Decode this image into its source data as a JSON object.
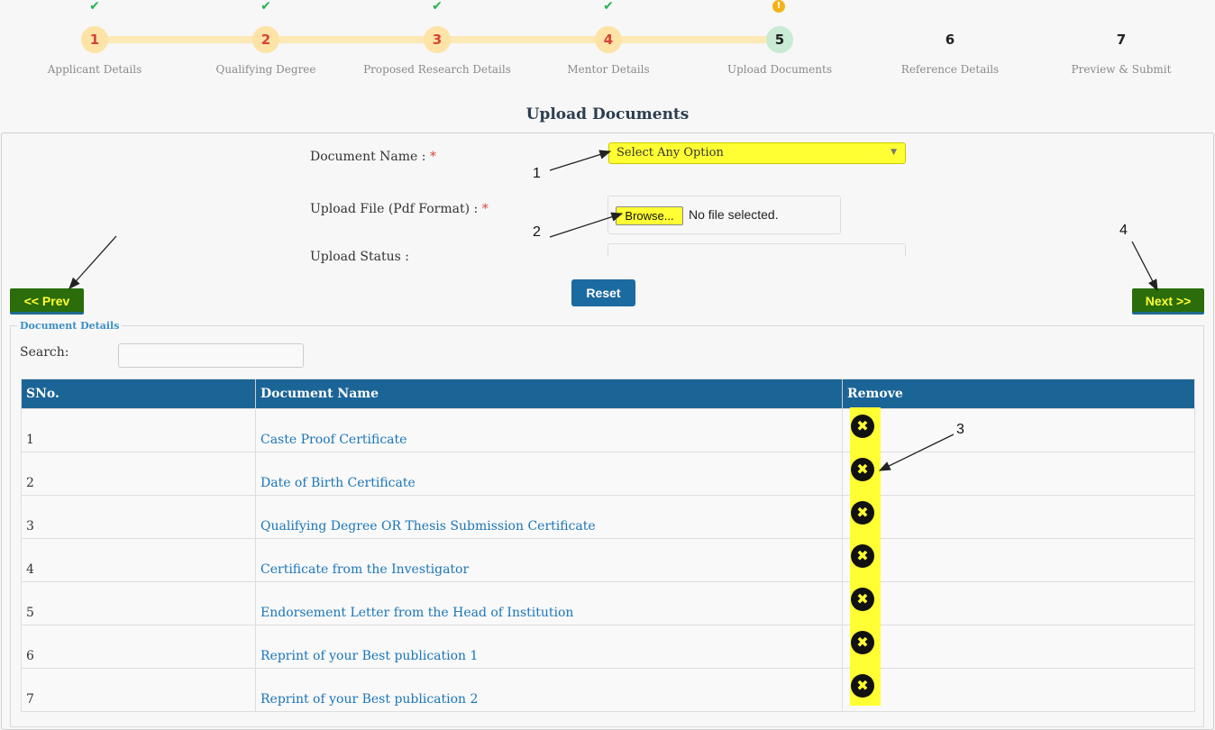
{
  "stepper": {
    "steps": [
      {
        "num": "1",
        "label": "Applicant Details",
        "status": "done",
        "flag": "✔"
      },
      {
        "num": "2",
        "label": "Qualifying Degree",
        "status": "done",
        "flag": "✔"
      },
      {
        "num": "3",
        "label": "Proposed Research Details",
        "status": "done",
        "flag": "✔"
      },
      {
        "num": "4",
        "label": "Mentor Details",
        "status": "done",
        "flag": "✔"
      },
      {
        "num": "5",
        "label": "Upload Documents",
        "status": "current",
        "flag": "!"
      },
      {
        "num": "6",
        "label": "Reference Details",
        "status": "todo",
        "flag": ""
      },
      {
        "num": "7",
        "label": "Preview & Submit",
        "status": "todo",
        "flag": ""
      }
    ]
  },
  "page_title": "Upload Documents",
  "form": {
    "doc_name_label": "Document Name : ",
    "required_mark": "*",
    "doc_name_select": "Select Any Option",
    "upload_file_label": "Upload File (Pdf Format) : ",
    "browse_label": "Browse...",
    "file_status": "No file selected.",
    "upload_status_label": "Upload Status :"
  },
  "buttons": {
    "prev": "<< Prev",
    "reset": "Reset",
    "next": "Next >>"
  },
  "documents": {
    "legend": "Document Details",
    "search_label": "Search:",
    "headers": [
      "SNo.",
      "Document Name",
      "Remove"
    ],
    "rows": [
      {
        "sno": "1",
        "name": "Caste Proof Certificate"
      },
      {
        "sno": "2",
        "name": "Date of Birth Certificate"
      },
      {
        "sno": "3",
        "name": "Qualifying Degree OR Thesis Submission Certificate"
      },
      {
        "sno": "4",
        "name": "Certificate from the Investigator"
      },
      {
        "sno": "5",
        "name": "Endorsement Letter from the Head of Institution"
      },
      {
        "sno": "6",
        "name": "Reprint of your Best publication 1"
      },
      {
        "sno": "7",
        "name": "Reprint of your Best publication 2"
      }
    ],
    "remove_icon": "✖"
  },
  "annotations": [
    "1",
    "2",
    "3",
    "4"
  ],
  "colors": {
    "highlight": "#ffff33",
    "header_blue": "#1b6496",
    "prev_next_green": "#2a6d0a",
    "link_blue": "#1a75b8"
  }
}
